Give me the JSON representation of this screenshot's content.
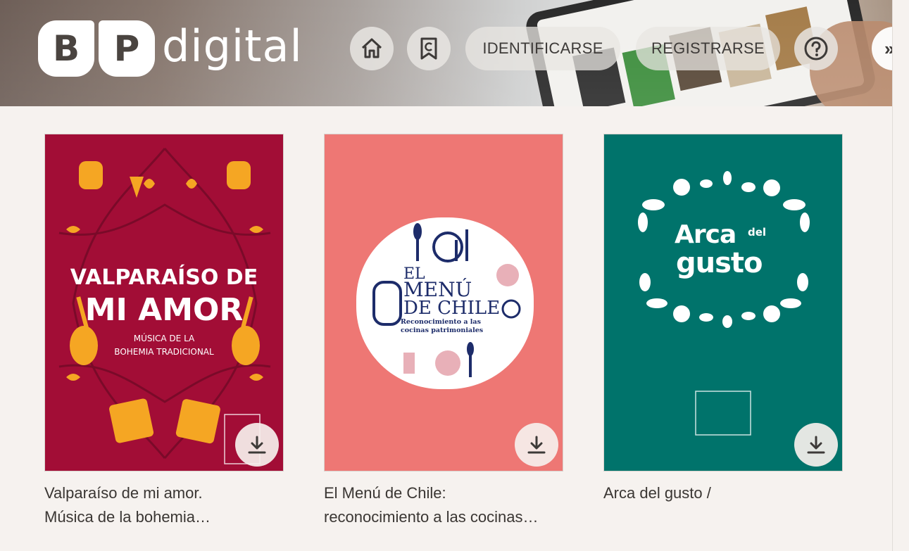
{
  "header": {
    "logo_letters": [
      "B",
      "P"
    ],
    "logo_word": "digital",
    "home_icon": "home-icon",
    "bookmark_icon": "bookmark-icon",
    "login_label": "IDENTIFICARSE",
    "register_label": "REGISTRARSE",
    "help_icon": "help-icon",
    "more_label": "»"
  },
  "books": [
    {
      "title_line1": "Valparaíso de mi amor.",
      "title_line2": "Música de la bohemia…",
      "cover": {
        "title_line1": "VALPARAÍSO DE",
        "title_line2": "MI AMOR",
        "subtitle_line1": "MÚSICA DE LA",
        "subtitle_line2": "BOHEMIA TRADICIONAL",
        "background": "#a20d36",
        "accent": "#f5a623"
      },
      "download_icon": "download-icon"
    },
    {
      "title_line1": "El Menú de Chile:",
      "title_line2": "reconocimiento a las cocinas…",
      "cover": {
        "title_el": "EL",
        "title_menu": "MENÚ",
        "title_dechile": "DE CHILE",
        "subtitle": "Reconocimiento a las cocinas patrimoniales",
        "background": "#ee7774",
        "accent": "#1d2c6a"
      },
      "download_icon": "download-icon"
    },
    {
      "title_line1": "Arca del gusto /",
      "title_line2": "",
      "cover": {
        "title_arca": "Arca",
        "title_del": "del",
        "title_gusto": "gusto",
        "background": "#00736b"
      },
      "download_icon": "download-icon"
    }
  ]
}
